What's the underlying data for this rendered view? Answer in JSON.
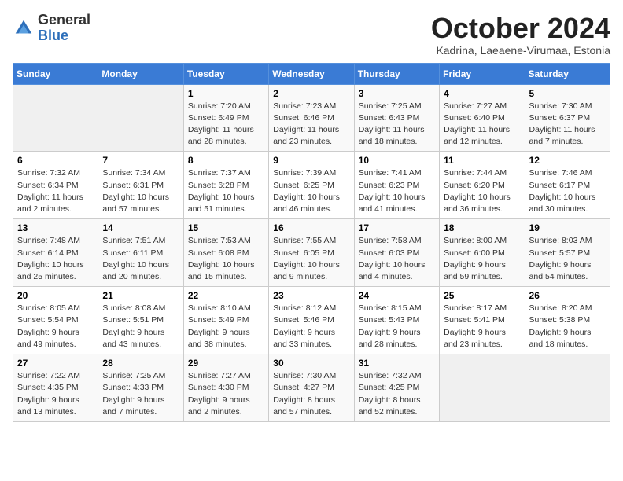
{
  "header": {
    "logo_line1": "General",
    "logo_line2": "Blue",
    "month": "October 2024",
    "location": "Kadrina, Laeaene-Virumaa, Estonia"
  },
  "weekdays": [
    "Sunday",
    "Monday",
    "Tuesday",
    "Wednesday",
    "Thursday",
    "Friday",
    "Saturday"
  ],
  "weeks": [
    [
      {
        "day": "",
        "detail": ""
      },
      {
        "day": "",
        "detail": ""
      },
      {
        "day": "1",
        "detail": "Sunrise: 7:20 AM\nSunset: 6:49 PM\nDaylight: 11 hours and 28 minutes."
      },
      {
        "day": "2",
        "detail": "Sunrise: 7:23 AM\nSunset: 6:46 PM\nDaylight: 11 hours and 23 minutes."
      },
      {
        "day": "3",
        "detail": "Sunrise: 7:25 AM\nSunset: 6:43 PM\nDaylight: 11 hours and 18 minutes."
      },
      {
        "day": "4",
        "detail": "Sunrise: 7:27 AM\nSunset: 6:40 PM\nDaylight: 11 hours and 12 minutes."
      },
      {
        "day": "5",
        "detail": "Sunrise: 7:30 AM\nSunset: 6:37 PM\nDaylight: 11 hours and 7 minutes."
      }
    ],
    [
      {
        "day": "6",
        "detail": "Sunrise: 7:32 AM\nSunset: 6:34 PM\nDaylight: 11 hours and 2 minutes."
      },
      {
        "day": "7",
        "detail": "Sunrise: 7:34 AM\nSunset: 6:31 PM\nDaylight: 10 hours and 57 minutes."
      },
      {
        "day": "8",
        "detail": "Sunrise: 7:37 AM\nSunset: 6:28 PM\nDaylight: 10 hours and 51 minutes."
      },
      {
        "day": "9",
        "detail": "Sunrise: 7:39 AM\nSunset: 6:25 PM\nDaylight: 10 hours and 46 minutes."
      },
      {
        "day": "10",
        "detail": "Sunrise: 7:41 AM\nSunset: 6:23 PM\nDaylight: 10 hours and 41 minutes."
      },
      {
        "day": "11",
        "detail": "Sunrise: 7:44 AM\nSunset: 6:20 PM\nDaylight: 10 hours and 36 minutes."
      },
      {
        "day": "12",
        "detail": "Sunrise: 7:46 AM\nSunset: 6:17 PM\nDaylight: 10 hours and 30 minutes."
      }
    ],
    [
      {
        "day": "13",
        "detail": "Sunrise: 7:48 AM\nSunset: 6:14 PM\nDaylight: 10 hours and 25 minutes."
      },
      {
        "day": "14",
        "detail": "Sunrise: 7:51 AM\nSunset: 6:11 PM\nDaylight: 10 hours and 20 minutes."
      },
      {
        "day": "15",
        "detail": "Sunrise: 7:53 AM\nSunset: 6:08 PM\nDaylight: 10 hours and 15 minutes."
      },
      {
        "day": "16",
        "detail": "Sunrise: 7:55 AM\nSunset: 6:05 PM\nDaylight: 10 hours and 9 minutes."
      },
      {
        "day": "17",
        "detail": "Sunrise: 7:58 AM\nSunset: 6:03 PM\nDaylight: 10 hours and 4 minutes."
      },
      {
        "day": "18",
        "detail": "Sunrise: 8:00 AM\nSunset: 6:00 PM\nDaylight: 9 hours and 59 minutes."
      },
      {
        "day": "19",
        "detail": "Sunrise: 8:03 AM\nSunset: 5:57 PM\nDaylight: 9 hours and 54 minutes."
      }
    ],
    [
      {
        "day": "20",
        "detail": "Sunrise: 8:05 AM\nSunset: 5:54 PM\nDaylight: 9 hours and 49 minutes."
      },
      {
        "day": "21",
        "detail": "Sunrise: 8:08 AM\nSunset: 5:51 PM\nDaylight: 9 hours and 43 minutes."
      },
      {
        "day": "22",
        "detail": "Sunrise: 8:10 AM\nSunset: 5:49 PM\nDaylight: 9 hours and 38 minutes."
      },
      {
        "day": "23",
        "detail": "Sunrise: 8:12 AM\nSunset: 5:46 PM\nDaylight: 9 hours and 33 minutes."
      },
      {
        "day": "24",
        "detail": "Sunrise: 8:15 AM\nSunset: 5:43 PM\nDaylight: 9 hours and 28 minutes."
      },
      {
        "day": "25",
        "detail": "Sunrise: 8:17 AM\nSunset: 5:41 PM\nDaylight: 9 hours and 23 minutes."
      },
      {
        "day": "26",
        "detail": "Sunrise: 8:20 AM\nSunset: 5:38 PM\nDaylight: 9 hours and 18 minutes."
      }
    ],
    [
      {
        "day": "27",
        "detail": "Sunrise: 7:22 AM\nSunset: 4:35 PM\nDaylight: 9 hours and 13 minutes."
      },
      {
        "day": "28",
        "detail": "Sunrise: 7:25 AM\nSunset: 4:33 PM\nDaylight: 9 hours and 7 minutes."
      },
      {
        "day": "29",
        "detail": "Sunrise: 7:27 AM\nSunset: 4:30 PM\nDaylight: 9 hours and 2 minutes."
      },
      {
        "day": "30",
        "detail": "Sunrise: 7:30 AM\nSunset: 4:27 PM\nDaylight: 8 hours and 57 minutes."
      },
      {
        "day": "31",
        "detail": "Sunrise: 7:32 AM\nSunset: 4:25 PM\nDaylight: 8 hours and 52 minutes."
      },
      {
        "day": "",
        "detail": ""
      },
      {
        "day": "",
        "detail": ""
      }
    ]
  ]
}
